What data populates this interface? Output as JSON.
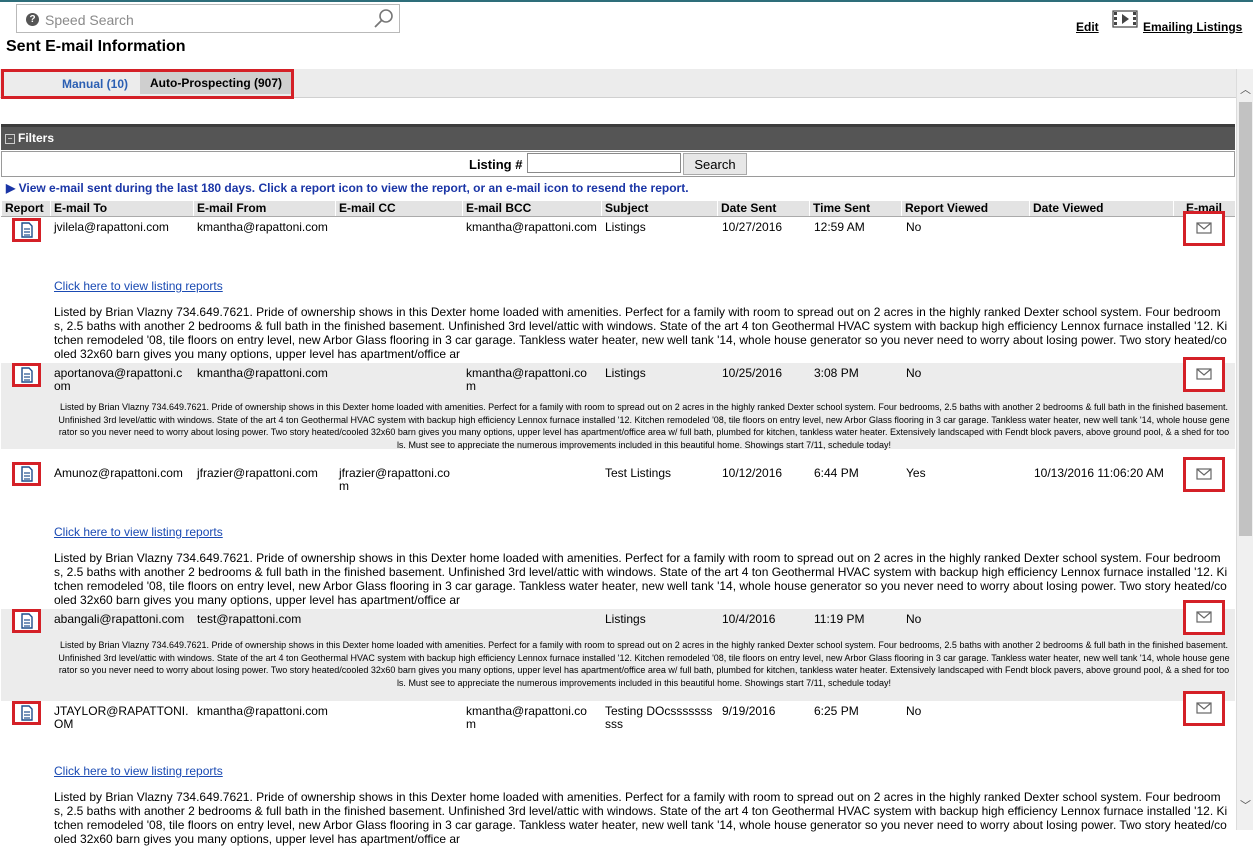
{
  "search": {
    "placeholder": "Speed Search"
  },
  "page_title": "Sent E-mail Information",
  "top_links": {
    "edit": "Edit",
    "emailing_listings": "Emailing Listings"
  },
  "tabs": [
    {
      "label": "Manual (10)"
    },
    {
      "label": "Auto-Prospecting (907)"
    }
  ],
  "filters": {
    "title": "Filters",
    "listing_label": "Listing #",
    "listing_value": "",
    "search_button": "Search"
  },
  "info_text": "View e-mail sent during the last 180 days. Click a report icon to view the report, or an e-mail icon to resend the report.",
  "columns": [
    "Report",
    "E-mail To",
    "E-mail From",
    "E-mail CC",
    "E-mail BCC",
    "Subject",
    "Date Sent",
    "Time Sent",
    "Report Viewed",
    "Date Viewed",
    "E-mail"
  ],
  "link_text": "Click here to view listing reports",
  "desc_short": "Listed by Brian Vlazny 734.649.7621. Pride of ownership shows in this Dexter home loaded with amenities. Perfect for a family with room to spread out on 2 acres in the highly ranked Dexter school system. Four bedrooms, 2.5 baths with another 2 bedrooms & full bath in the finished basement. Unfinished 3rd level/attic with windows. State of the art 4 ton Geothermal HVAC system with backup high efficiency Lennox furnace installed '12. Kitchen remodeled '08, tile floors on entry level, new Arbor Glass flooring in 3 car garage. Tankless water heater, new well tank '14, whole house generator so you never need to worry about losing power. Two story heated/cooled 32x60 barn gives you many options, upper level has apartment/office ar",
  "desc_full": "Listed by Brian Vlazny 734.649.7621. Pride of ownership shows in this Dexter home loaded with amenities. Perfect for a family with room to spread out on 2 acres in the highly ranked Dexter school system. Four bedrooms, 2.5 baths with another 2 bedrooms & full bath in the finished basement. Unfinished 3rd level/attic with windows. State of the art 4 ton Geothermal HVAC system with backup high efficiency Lennox furnace installed '12. Kitchen remodeled '08, tile floors on entry level, new Arbor Glass flooring in 3 car garage. Tankless water heater, new well tank '14, whole house generator so you never need to worry about losing power. Two story heated/cooled 32x60 barn gives you many options, upper level has apartment/office area w/ full bath, plumbed for kitchen, tankless water heater. Extensively landscaped with Fendt block pavers, above ground pool, & a shed for tools. Must see to appreciate the numerous improvements included in this beautiful home. Showings start 7/11, schedule today!",
  "rows": [
    {
      "to": "jvilela@rapattoni.com",
      "from": "kmantha@rapattoni.com",
      "cc": "",
      "bcc": "kmantha@rapattoni.com",
      "subject": "Listings",
      "date_sent": "10/27/2016",
      "time_sent": "12:59 AM",
      "viewed": "No",
      "date_viewed": ""
    },
    {
      "to": "aportanova@rapattoni.com",
      "from": "kmantha@rapattoni.com",
      "cc": "",
      "bcc": "kmantha@rapattoni.com",
      "subject": "Listings",
      "date_sent": "10/25/2016",
      "time_sent": "3:08 PM",
      "viewed": "No",
      "date_viewed": ""
    },
    {
      "to": "Amunoz@rapattoni.com",
      "from": "jfrazier@rapattoni.com",
      "cc": "jfrazier@rapattoni.com",
      "bcc": "",
      "subject": "Test Listings",
      "date_sent": "10/12/2016",
      "time_sent": "6:44 PM",
      "viewed": "Yes",
      "date_viewed": "10/13/2016 11:06:20 AM"
    },
    {
      "to": "abangali@rapattoni.com",
      "from": "test@rapattoni.com",
      "cc": "",
      "bcc": "",
      "subject": "Listings",
      "date_sent": "10/4/2016",
      "time_sent": "11:19 PM",
      "viewed": "No",
      "date_viewed": ""
    },
    {
      "to": "JTAYLOR@RAPATTONI.OM",
      "from": "kmantha@rapattoni.com",
      "cc": "",
      "bcc": "kmantha@rapattoni.com",
      "subject": "Testing DOcssssssssss",
      "date_sent": "9/19/2016",
      "time_sent": "6:25 PM",
      "viewed": "No",
      "date_viewed": ""
    }
  ]
}
